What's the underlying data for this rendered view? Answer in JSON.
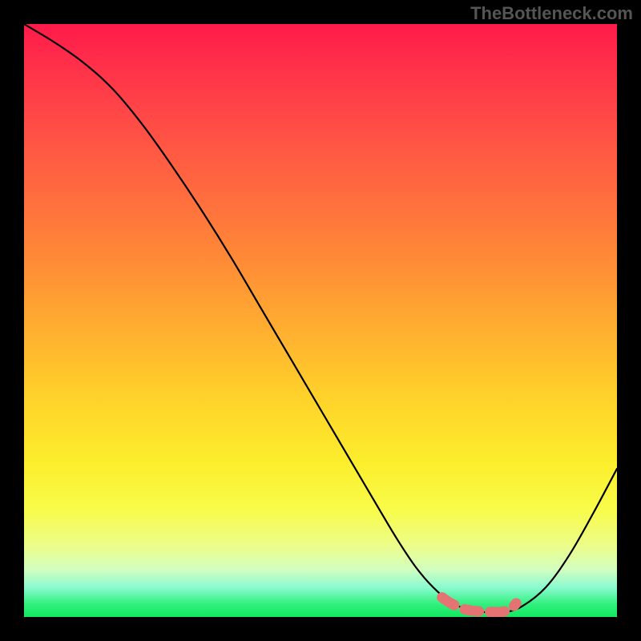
{
  "watermark": "TheBottleneck.com",
  "chart_data": {
    "type": "line",
    "title": "",
    "xlabel": "",
    "ylabel": "",
    "xlim": [
      0,
      100
    ],
    "ylim": [
      0,
      100
    ],
    "series": [
      {
        "name": "bottleneck-curve",
        "x": [
          0,
          5,
          10,
          15,
          20,
          25,
          30,
          35,
          40,
          45,
          50,
          55,
          60,
          63,
          66,
          69,
          72,
          75,
          78,
          81,
          84,
          88,
          92,
          96,
          100
        ],
        "y": [
          100,
          97,
          93.5,
          89,
          83,
          76,
          68.5,
          60.5,
          52,
          43.5,
          35,
          26.5,
          18,
          13,
          8.5,
          5,
          2.5,
          1.2,
          0.8,
          0.8,
          1.8,
          5,
          10.5,
          17.5,
          25
        ]
      }
    ],
    "highlight": {
      "name": "optimal-zone",
      "color": "#e57373",
      "x": [
        70.5,
        72,
        74,
        75,
        76,
        77.5,
        79,
        80.5,
        82,
        83
      ],
      "y": [
        3.3,
        2.3,
        1.4,
        1.15,
        1.0,
        0.9,
        0.85,
        0.85,
        1.3,
        2.3
      ]
    },
    "background_gradient": {
      "orientation": "vertical",
      "stops": [
        {
          "pos": 0,
          "color": "#ff1a4a"
        },
        {
          "pos": 50,
          "color": "#ffb030"
        },
        {
          "pos": 80,
          "color": "#f8fc4a"
        },
        {
          "pos": 100,
          "color": "#13e85f"
        }
      ]
    }
  }
}
